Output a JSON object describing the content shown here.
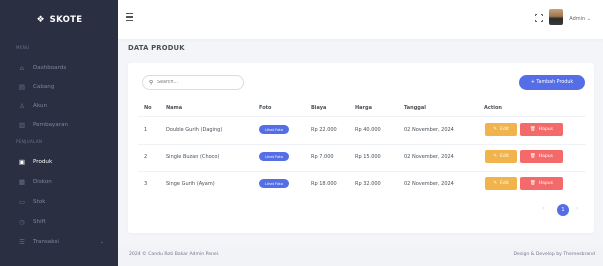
{
  "brand": {
    "name": "SKOTE"
  },
  "sidebar": {
    "section_menu": "MENU",
    "section_penjualan": "PENJUALAN",
    "items": [
      {
        "label": "Dashboards",
        "icon": "home-icon"
      },
      {
        "label": "Cabang",
        "icon": "file-icon"
      },
      {
        "label": "Akun",
        "icon": "user-icon"
      },
      {
        "label": "Pembayaran",
        "icon": "bar-chart-icon"
      },
      {
        "label": "Produk",
        "icon": "box-icon",
        "active": true
      },
      {
        "label": "Diskon",
        "icon": "tag-icon"
      },
      {
        "label": "Stok",
        "icon": "card-icon"
      },
      {
        "label": "Shift",
        "icon": "clock-icon"
      },
      {
        "label": "Transaksi",
        "icon": "list-icon"
      }
    ]
  },
  "topbar": {
    "user_name": "Admin",
    "chevron": "⌄"
  },
  "page": {
    "title": "DATA PRODUK"
  },
  "toolbar": {
    "search_placeholder": "Search...",
    "add_label": "+ Tambah Produk"
  },
  "table": {
    "headers": [
      "No",
      "Nama",
      "Foto",
      "Biaya",
      "Harga",
      "Tanggal",
      "Action"
    ],
    "rows": [
      {
        "no": "1",
        "nama": "Double Gurih (Daging)",
        "foto": "Lihat Foto",
        "biaya": "Rp 22.000",
        "harga": "Rp 40.000",
        "tanggal": "02 November, 2024"
      },
      {
        "no": "2",
        "nama": "Single Buzan (Choco)",
        "foto": "Lihat Foto",
        "biaya": "Rp 7.000",
        "harga": "Rp 15.000",
        "tanggal": "02 November, 2024"
      },
      {
        "no": "3",
        "nama": "Singe Gurih (Ayam)",
        "foto": "Lihat Foto",
        "biaya": "Rp 18.000",
        "harga": "Rp 32.000",
        "tanggal": "02 November, 2024"
      }
    ],
    "edit_label": "Edit",
    "delete_label": "Hapus"
  },
  "pagination": {
    "current": "1",
    "prev": "‹",
    "next": "›"
  },
  "footer": {
    "left": "2024 © Candu Roti Bakar Admin Panel.",
    "right": "Design & Develop by Themesbrand"
  },
  "colors": {
    "primary": "#556ee6",
    "warning": "#f1b44c",
    "danger": "#f46a6a",
    "sidebar": "#2a3042"
  }
}
